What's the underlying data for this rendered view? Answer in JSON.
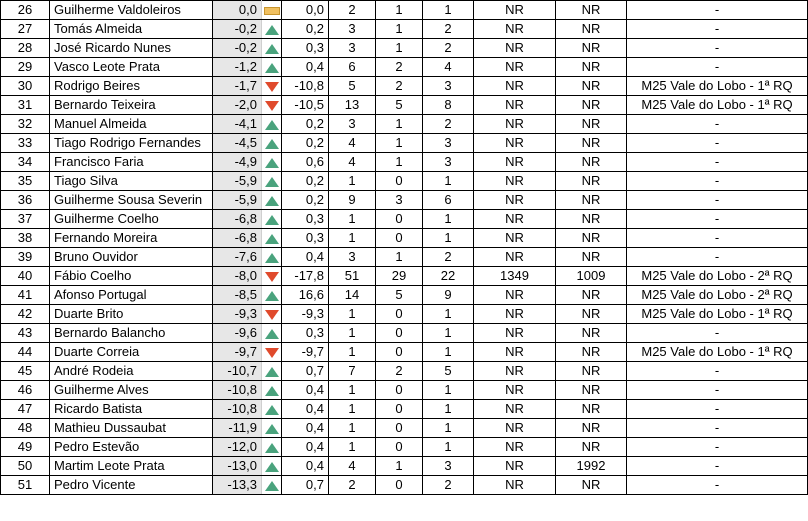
{
  "colors": {
    "up": "#4aa37d",
    "down": "#e04a2c",
    "flat": "#f0c060",
    "diff_bg": "#e7e7e7"
  },
  "rows": [
    {
      "rank": "26",
      "name": "Guilherme Valdoleiros",
      "diff": "0,0",
      "trend": "flat",
      "val": "0,0",
      "a": "2",
      "b": "1",
      "c": "1",
      "d": "NR",
      "e": "NR",
      "event": "-"
    },
    {
      "rank": "27",
      "name": "Tomás Almeida",
      "diff": "-0,2",
      "trend": "up",
      "val": "0,2",
      "a": "3",
      "b": "1",
      "c": "2",
      "d": "NR",
      "e": "NR",
      "event": "-"
    },
    {
      "rank": "28",
      "name": "José Ricardo Nunes",
      "diff": "-0,2",
      "trend": "up",
      "val": "0,3",
      "a": "3",
      "b": "1",
      "c": "2",
      "d": "NR",
      "e": "NR",
      "event": "-"
    },
    {
      "rank": "29",
      "name": "Vasco Leote Prata",
      "diff": "-1,2",
      "trend": "up",
      "val": "0,4",
      "a": "6",
      "b": "2",
      "c": "4",
      "d": "NR",
      "e": "NR",
      "event": "-"
    },
    {
      "rank": "30",
      "name": "Rodrigo Beires",
      "diff": "-1,7",
      "trend": "down",
      "val": "-10,8",
      "a": "5",
      "b": "2",
      "c": "3",
      "d": "NR",
      "e": "NR",
      "event": "M25 Vale do Lobo - 1ª RQ"
    },
    {
      "rank": "31",
      "name": "Bernardo Teixeira",
      "diff": "-2,0",
      "trend": "down",
      "val": "-10,5",
      "a": "13",
      "b": "5",
      "c": "8",
      "d": "NR",
      "e": "NR",
      "event": "M25 Vale do Lobo - 1ª RQ"
    },
    {
      "rank": "32",
      "name": "Manuel Almeida",
      "diff": "-4,1",
      "trend": "up",
      "val": "0,2",
      "a": "3",
      "b": "1",
      "c": "2",
      "d": "NR",
      "e": "NR",
      "event": "-"
    },
    {
      "rank": "33",
      "name": "Tiago Rodrigo Fernandes",
      "diff": "-4,5",
      "trend": "up",
      "val": "0,2",
      "a": "4",
      "b": "1",
      "c": "3",
      "d": "NR",
      "e": "NR",
      "event": "-"
    },
    {
      "rank": "34",
      "name": "Francisco Faria",
      "diff": "-4,9",
      "trend": "up",
      "val": "0,6",
      "a": "4",
      "b": "1",
      "c": "3",
      "d": "NR",
      "e": "NR",
      "event": "-"
    },
    {
      "rank": "35",
      "name": "Tiago Silva",
      "diff": "-5,9",
      "trend": "up",
      "val": "0,2",
      "a": "1",
      "b": "0",
      "c": "1",
      "d": "NR",
      "e": "NR",
      "event": "-"
    },
    {
      "rank": "36",
      "name": "Guilherme Sousa Severin",
      "diff": "-5,9",
      "trend": "up",
      "val": "0,2",
      "a": "9",
      "b": "3",
      "c": "6",
      "d": "NR",
      "e": "NR",
      "event": "-"
    },
    {
      "rank": "37",
      "name": "Guilherme Coelho",
      "diff": "-6,8",
      "trend": "up",
      "val": "0,3",
      "a": "1",
      "b": "0",
      "c": "1",
      "d": "NR",
      "e": "NR",
      "event": "-"
    },
    {
      "rank": "38",
      "name": "Fernando Moreira",
      "diff": "-6,8",
      "trend": "up",
      "val": "0,3",
      "a": "1",
      "b": "0",
      "c": "1",
      "d": "NR",
      "e": "NR",
      "event": "-"
    },
    {
      "rank": "39",
      "name": "Bruno Ouvidor",
      "diff": "-7,6",
      "trend": "up",
      "val": "0,4",
      "a": "3",
      "b": "1",
      "c": "2",
      "d": "NR",
      "e": "NR",
      "event": "-"
    },
    {
      "rank": "40",
      "name": "Fábio Coelho",
      "diff": "-8,0",
      "trend": "down",
      "val": "-17,8",
      "a": "51",
      "b": "29",
      "c": "22",
      "d": "1349",
      "e": "1009",
      "event": "M25 Vale do Lobo - 2ª RQ"
    },
    {
      "rank": "41",
      "name": "Afonso Portugal",
      "diff": "-8,5",
      "trend": "up",
      "val": "16,6",
      "a": "14",
      "b": "5",
      "c": "9",
      "d": "NR",
      "e": "NR",
      "event": "M25 Vale do Lobo - 2ª RQ"
    },
    {
      "rank": "42",
      "name": "Duarte Brito",
      "diff": "-9,3",
      "trend": "down",
      "val": "-9,3",
      "a": "1",
      "b": "0",
      "c": "1",
      "d": "NR",
      "e": "NR",
      "event": "M25 Vale do Lobo - 1ª RQ"
    },
    {
      "rank": "43",
      "name": "Bernardo Balancho",
      "diff": "-9,6",
      "trend": "up",
      "val": "0,3",
      "a": "1",
      "b": "0",
      "c": "1",
      "d": "NR",
      "e": "NR",
      "event": "-"
    },
    {
      "rank": "44",
      "name": "Duarte Correia",
      "diff": "-9,7",
      "trend": "down",
      "val": "-9,7",
      "a": "1",
      "b": "0",
      "c": "1",
      "d": "NR",
      "e": "NR",
      "event": "M25 Vale do Lobo - 1ª RQ"
    },
    {
      "rank": "45",
      "name": "André Rodeia",
      "diff": "-10,7",
      "trend": "up",
      "val": "0,7",
      "a": "7",
      "b": "2",
      "c": "5",
      "d": "NR",
      "e": "NR",
      "event": "-"
    },
    {
      "rank": "46",
      "name": "Guilherme Alves",
      "diff": "-10,8",
      "trend": "up",
      "val": "0,4",
      "a": "1",
      "b": "0",
      "c": "1",
      "d": "NR",
      "e": "NR",
      "event": "-"
    },
    {
      "rank": "47",
      "name": "Ricardo Batista",
      "diff": "-10,8",
      "trend": "up",
      "val": "0,4",
      "a": "1",
      "b": "0",
      "c": "1",
      "d": "NR",
      "e": "NR",
      "event": "-"
    },
    {
      "rank": "48",
      "name": "Mathieu Dussaubat",
      "diff": "-11,9",
      "trend": "up",
      "val": "0,4",
      "a": "1",
      "b": "0",
      "c": "1",
      "d": "NR",
      "e": "NR",
      "event": "-"
    },
    {
      "rank": "49",
      "name": "Pedro Estevão",
      "diff": "-12,0",
      "trend": "up",
      "val": "0,4",
      "a": "1",
      "b": "0",
      "c": "1",
      "d": "NR",
      "e": "NR",
      "event": "-"
    },
    {
      "rank": "50",
      "name": "Martim Leote Prata",
      "diff": "-13,0",
      "trend": "up",
      "val": "0,4",
      "a": "4",
      "b": "1",
      "c": "3",
      "d": "NR",
      "e": "1992",
      "event": "-"
    },
    {
      "rank": "51",
      "name": "Pedro Vicente",
      "diff": "-13,3",
      "trend": "up",
      "val": "0,7",
      "a": "2",
      "b": "0",
      "c": "2",
      "d": "NR",
      "e": "NR",
      "event": "-"
    }
  ]
}
